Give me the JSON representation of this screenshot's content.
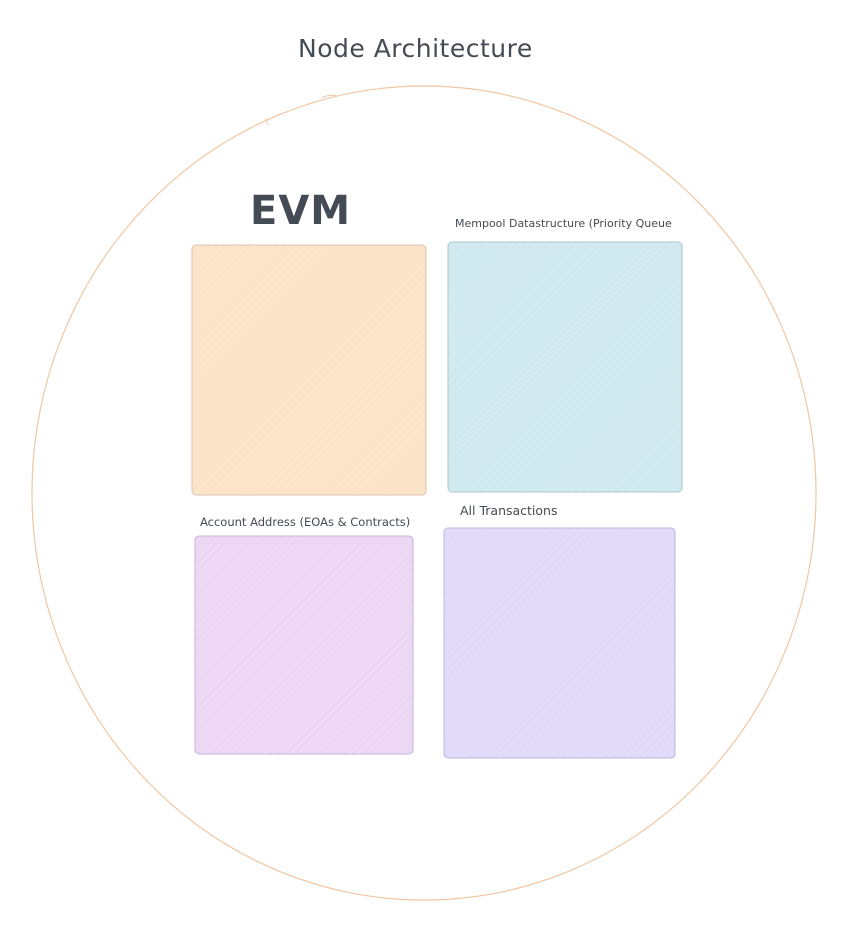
{
  "diagram": {
    "title": "Node Architecture",
    "container": {
      "shape": "circle",
      "stroke_color": "#f0c7a3"
    },
    "boxes": [
      {
        "id": "evm",
        "label": "EVM",
        "fill_color": "#fbe3c8",
        "stroke_color": "#d9c2b0"
      },
      {
        "id": "mempool",
        "label": "Mempool Datastructure (Priority Queue",
        "fill_color": "#cfe9ee",
        "stroke_color": "#aac6cf"
      },
      {
        "id": "account-address",
        "label": "Account Address (EOAs & Contracts)",
        "fill_color": "#ecd6f4",
        "stroke_color": "#c9b3d4"
      },
      {
        "id": "all-transactions",
        "label": "All Transactions",
        "fill_color": "#e0d9f8",
        "stroke_color": "#bdb3d8"
      }
    ],
    "text_color": "#454b55"
  }
}
